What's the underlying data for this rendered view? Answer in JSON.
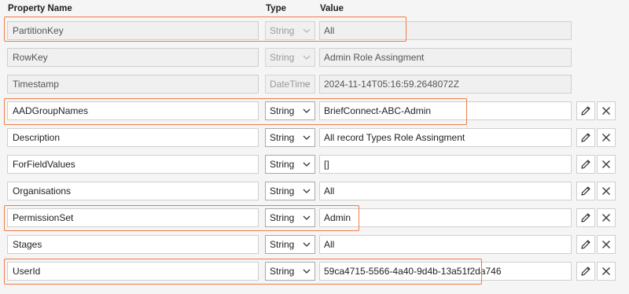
{
  "columns": {
    "name": "Property Name",
    "type": "Type",
    "value": "Value"
  },
  "rows": [
    {
      "name": "PartitionKey",
      "type": "String",
      "value": "All",
      "readonly": true
    },
    {
      "name": "RowKey",
      "type": "String",
      "value": "Admin  Role Assingment",
      "readonly": true
    },
    {
      "name": "Timestamp",
      "type": "DateTime",
      "value": "2024-11-14T05:16:59.2648072Z",
      "readonly": true
    },
    {
      "name": "AADGroupNames",
      "type": "String",
      "value": "BriefConnect-ABC-Admin",
      "readonly": false
    },
    {
      "name": "Description",
      "type": "String",
      "value": "All record Types Role Assingment",
      "readonly": false
    },
    {
      "name": "ForFieldValues",
      "type": "String",
      "value": "[]",
      "readonly": false
    },
    {
      "name": "Organisations",
      "type": "String",
      "value": "All",
      "readonly": false
    },
    {
      "name": "PermissionSet",
      "type": "String",
      "value": "Admin",
      "readonly": false
    },
    {
      "name": "Stages",
      "type": "String",
      "value": "All",
      "readonly": false
    },
    {
      "name": "UserId",
      "type": "String",
      "value": "59ca4715-5566-4a40-9d4b-13a51f2da746",
      "readonly": false
    }
  ],
  "icons": {
    "edit": "pencil-icon",
    "delete": "close-icon",
    "dropdown": "chevron-down-icon"
  },
  "colors": {
    "highlight": "#ef7d4a",
    "readonly_bg": "#f0f0f0",
    "background": "#f5f5f5"
  }
}
